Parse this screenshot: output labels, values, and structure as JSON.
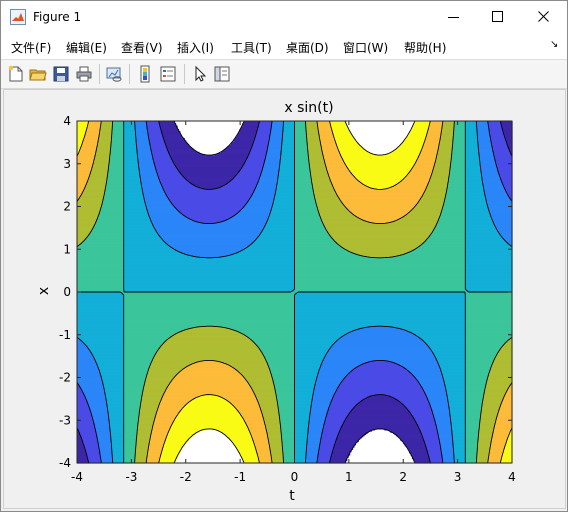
{
  "window": {
    "title": "Figure 1",
    "icons": {
      "app": "matlab-logo-icon",
      "minimize": "minimize-icon",
      "maximize": "maximize-icon",
      "close": "close-icon"
    }
  },
  "menubar": {
    "items": [
      {
        "label": "文件(F)"
      },
      {
        "label": "编辑(E)"
      },
      {
        "label": "查看(V)"
      },
      {
        "label": "插入(I)"
      },
      {
        "label": "工具(T)"
      },
      {
        "label": "桌面(D)"
      },
      {
        "label": "窗口(W)"
      },
      {
        "label": "帮助(H)"
      }
    ],
    "overflow_icon": "menu-dock-arrow-icon"
  },
  "toolbar": {
    "tools": [
      {
        "icon": "new-figure-icon"
      },
      {
        "icon": "open-file-icon"
      },
      {
        "icon": "save-icon"
      },
      {
        "icon": "print-icon"
      },
      {
        "icon": "link-plot-icon"
      },
      {
        "icon": "insert-colorbar-icon"
      },
      {
        "icon": "insert-legend-icon"
      },
      {
        "icon": "edit-plot-icon"
      },
      {
        "icon": "property-inspector-icon"
      }
    ]
  },
  "chart_data": {
    "type": "contourf",
    "function": "x*sin(t)",
    "title": "x sin(t)",
    "xlabel": "t",
    "ylabel": "x",
    "xlim": [
      -4,
      4
    ],
    "ylim": [
      -4,
      4
    ],
    "xticks": [
      -4,
      -3,
      -2,
      -1,
      0,
      1,
      2,
      3,
      4
    ],
    "yticks": [
      -4,
      -3,
      -2,
      -1,
      0,
      1,
      2,
      3,
      4
    ],
    "levels": [
      -3.2,
      -2.4,
      -1.6,
      -0.8,
      0,
      0.8,
      1.6,
      2.4,
      3.2
    ],
    "colormap": [
      "#3d26a8",
      "#4a4ae6",
      "#2b86f8",
      "#12afd8",
      "#3ac59b",
      "#afbd33",
      "#fdbb3a",
      "#f9fb15"
    ],
    "contour_line_color": "#000000",
    "background": "#ffffff"
  }
}
